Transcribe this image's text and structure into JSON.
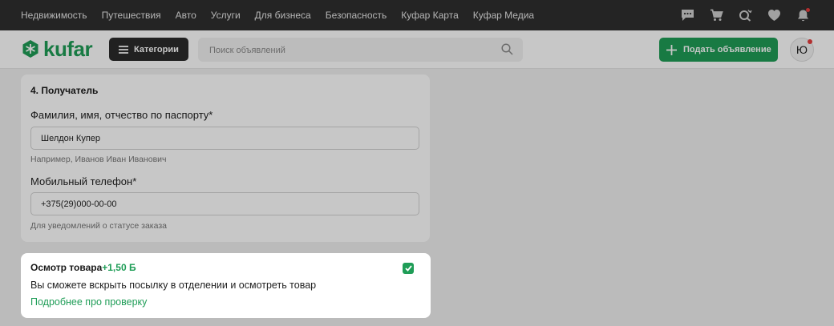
{
  "topnav": {
    "links": [
      "Недвижимость",
      "Путешествия",
      "Авто",
      "Услуги",
      "Для бизнеса",
      "Безопасность",
      "Куфар Карта",
      "Куфар Медиа"
    ],
    "icons": [
      "chat-icon",
      "cart-icon",
      "search-favorites-icon",
      "heart-icon",
      "bell-icon"
    ]
  },
  "header": {
    "logo_text": "kufar",
    "categories_label": "Категории",
    "search_placeholder": "Поиск объявлений",
    "post_label": "Подать объявление",
    "avatar_letter": "Ю"
  },
  "recipient": {
    "heading": "4. Получатель",
    "name_label": "Фамилия, имя, отчество по паспорту*",
    "name_value": "Шелдон Купер",
    "name_hint": "Например, Иванов Иван Иванович",
    "phone_label": "Мобильный телефон*",
    "phone_value": "+375(29)000-00-00",
    "phone_hint": "Для уведомлений о статусе заказа"
  },
  "inspection": {
    "title": "Осмотр товара",
    "price": "+1,50 Б",
    "description": "Вы сможете вскрыть посылку в отделении и осмотреть товар",
    "link": "Подробнее про проверку",
    "checked": true
  },
  "colors": {
    "accent": "#1f9d57",
    "topnav_bg": "#2f2f2f",
    "notification_dot": "#e43d3d"
  }
}
